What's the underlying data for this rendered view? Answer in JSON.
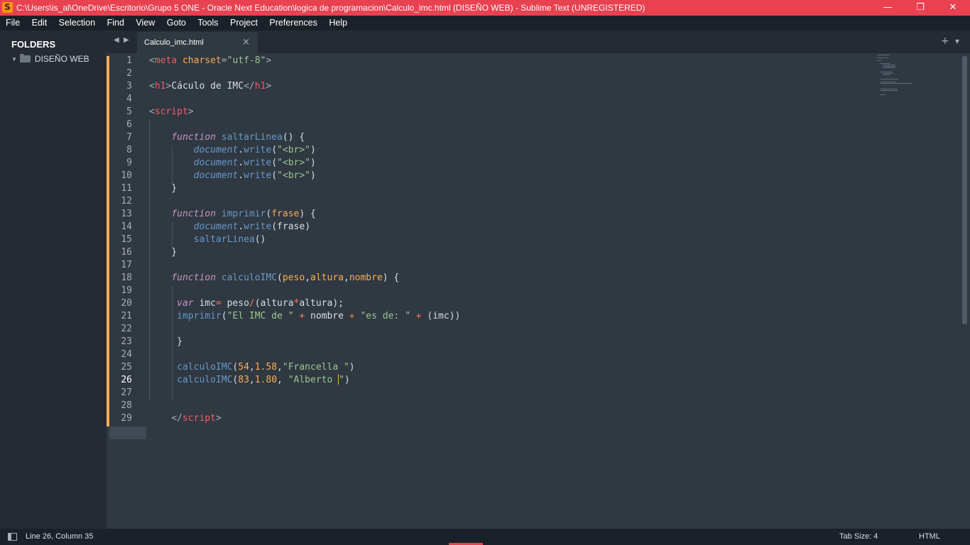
{
  "window": {
    "title": "C:\\Users\\is_al\\OneDrive\\Escritorio\\Grupo 5 ONE - Oracle Next Education\\logica de programacion\\Calculo_imc.html (DISEÑO WEB) - Sublime Text (UNREGISTERED)",
    "app_icon": "S",
    "minimize": "—",
    "restore": "❐",
    "close": "✕"
  },
  "menu": [
    "File",
    "Edit",
    "Selection",
    "Find",
    "View",
    "Goto",
    "Tools",
    "Project",
    "Preferences",
    "Help"
  ],
  "sidebar": {
    "heading": "FOLDERS",
    "folder": "DISEÑO WEB"
  },
  "tabs": {
    "active": "Calculo_imc.html",
    "close": "×",
    "add": "+",
    "menu": "▾"
  },
  "editor": {
    "current_line": 26,
    "lines": [
      {
        "n": "1"
      },
      {
        "n": "2"
      },
      {
        "n": "3"
      },
      {
        "n": "4"
      },
      {
        "n": "5"
      },
      {
        "n": "6"
      },
      {
        "n": "7"
      },
      {
        "n": "8"
      },
      {
        "n": "9"
      },
      {
        "n": "10"
      },
      {
        "n": "11"
      },
      {
        "n": "12"
      },
      {
        "n": "13"
      },
      {
        "n": "14"
      },
      {
        "n": "15"
      },
      {
        "n": "16"
      },
      {
        "n": "17"
      },
      {
        "n": "18"
      },
      {
        "n": "19"
      },
      {
        "n": "20"
      },
      {
        "n": "21"
      },
      {
        "n": "22"
      },
      {
        "n": "23"
      },
      {
        "n": "24"
      },
      {
        "n": "25"
      },
      {
        "n": "26"
      },
      {
        "n": "27"
      },
      {
        "n": "28"
      },
      {
        "n": "29"
      }
    ],
    "tokens": {
      "meta_tag": "meta",
      "charset_attr": "charset",
      "charset_val": "\"utf-8\"",
      "h1": "h1",
      "h1_text": "Cáculo de IMC",
      "script": "script",
      "kw_function": "function",
      "kw_var": "var",
      "fn_saltar": "saltarLinea",
      "fn_imprimir": "imprimir",
      "fn_calculo": "calculoIMC",
      "obj_document": "document",
      "m_write": "write",
      "str_br": "\"<br>\"",
      "p_frase": "frase",
      "p_peso": "peso",
      "p_altura": "altura",
      "p_nombre": "nombre",
      "v_imc": "imc",
      "str_el": "\"El IMC de \"",
      "str_es": "\"es de: \"",
      "n54": "54",
      "n158": "1.58",
      "n83": "83",
      "n180": "1.80",
      "str_francella": "\"Francella \"",
      "str_alberto_a": "\"Alberto ",
      "str_alberto_b": "\""
    }
  },
  "status": {
    "cursor": "Line 26, Column 35",
    "tab_size": "Tab Size: 4",
    "syntax": "HTML"
  }
}
